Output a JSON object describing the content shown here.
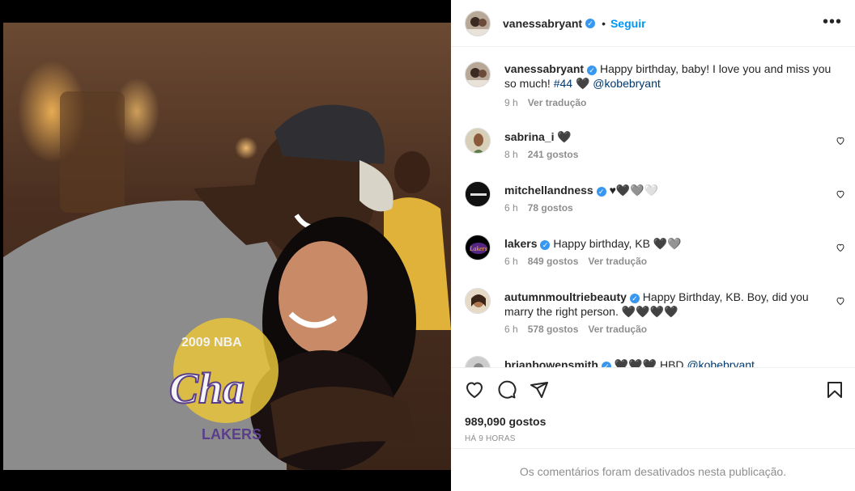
{
  "post": {
    "author": "vanessabryant",
    "follow_label": "Seguir",
    "dot": "•",
    "more_label": "•••",
    "caption_text": "Happy birthday, baby! I love you and miss you so much!",
    "caption_hashtag": "#44",
    "caption_heart": "🖤",
    "caption_mention": "@kobebryant",
    "caption_time": "9 h",
    "caption_translate": "Ver tradução"
  },
  "comments": [
    {
      "user": "sabrina_i",
      "text": "🖤",
      "time": "8 h",
      "likes": "241 gostos",
      "translate": ""
    },
    {
      "user": "mitchellandness",
      "text": "♥🖤🩶🤍",
      "time": "6 h",
      "likes": "78 gostos",
      "translate": ""
    },
    {
      "user": "lakers",
      "text": "Happy birthday, KB 🖤🩶",
      "time": "6 h",
      "likes": "849 gostos",
      "translate": "Ver tradução"
    },
    {
      "user": "autumnmoultriebeauty",
      "text": "Happy Birthday, KB. Boy, did you marry the right person. 🖤🖤🖤🖤",
      "time": "6 h",
      "likes": "578 gostos",
      "translate": "Ver tradução"
    },
    {
      "user": "brianbowensmith",
      "text": "🖤🖤🖤 HBD",
      "mention": "@kobebryant"
    }
  ],
  "footer": {
    "likes": "989,090 gostos",
    "ago": "HÁ 9 HORAS",
    "comments_disabled": "Os comentários foram desativados nesta publicação."
  },
  "colors": {
    "link": "#0095f6",
    "verified": "#3897f0",
    "muted": "#8e8e8e",
    "mention": "#00376b"
  }
}
